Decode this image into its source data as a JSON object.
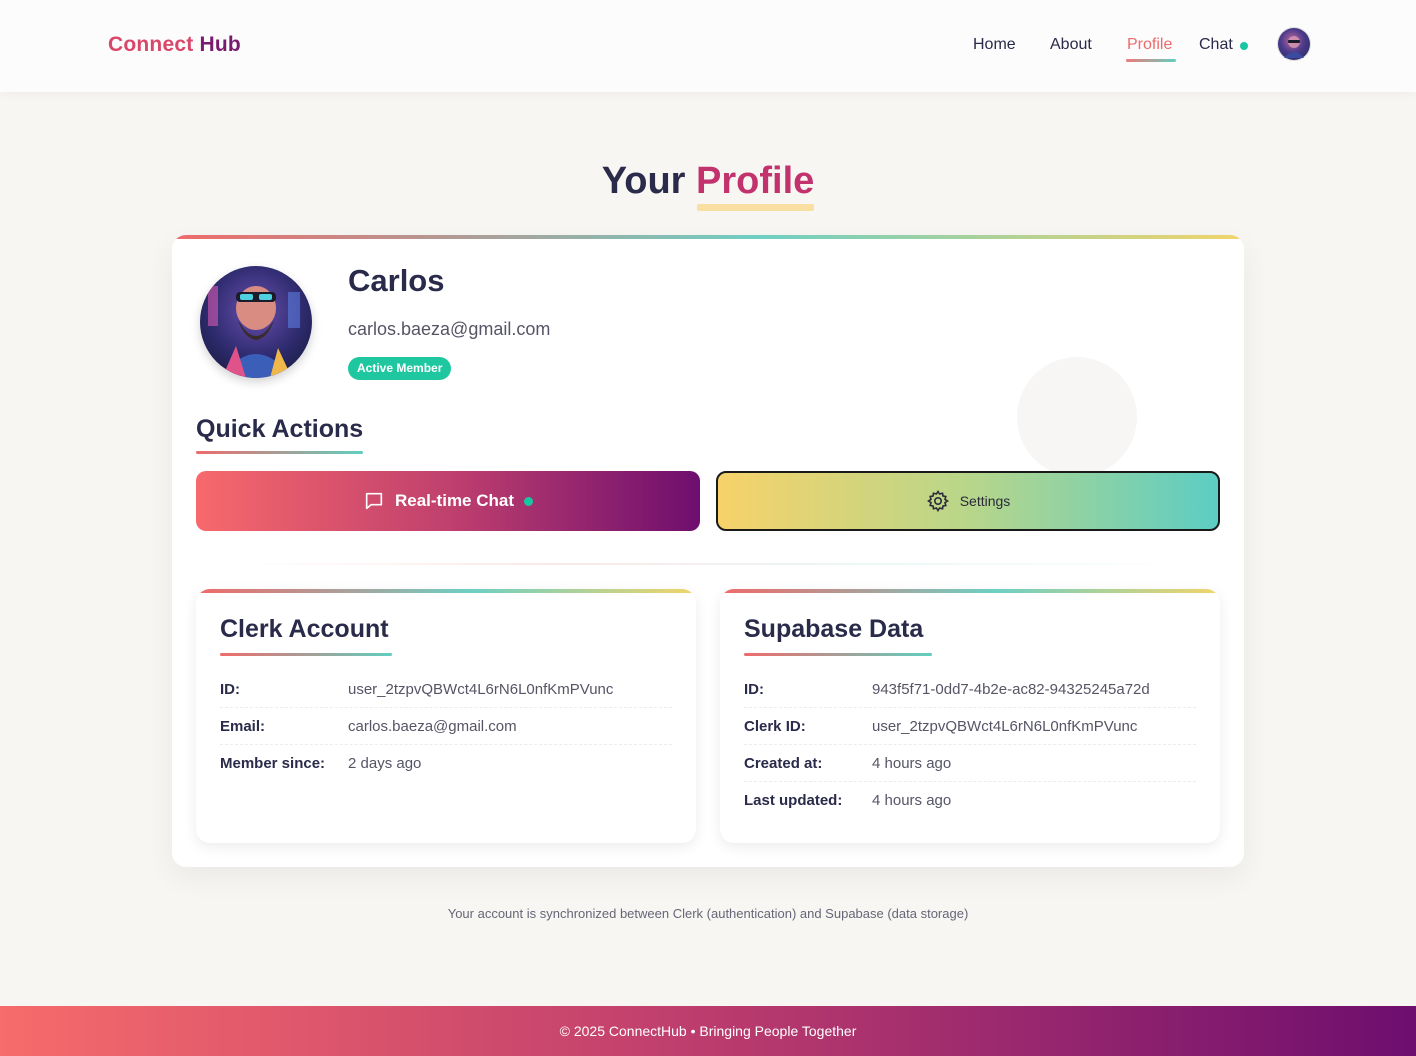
{
  "header": {
    "logo_part1": "Connect",
    "logo_part2": "Hub",
    "nav": [
      {
        "label": "Home"
      },
      {
        "label": "About"
      },
      {
        "label": "Profile"
      },
      {
        "label": "Chat"
      }
    ],
    "active_nav": "Profile"
  },
  "page": {
    "title_part1": "Your",
    "title_part2": "Profile"
  },
  "profile": {
    "name": "Carlos",
    "email": "carlos.baeza@gmail.com",
    "badge": "Active Member"
  },
  "quick_actions": {
    "title": "Quick Actions",
    "chat_label": "Real-time Chat",
    "settings_label": "Settings"
  },
  "clerk": {
    "title": "Clerk Account",
    "rows": [
      {
        "key": "ID:",
        "value": "user_2tzpvQBWct4L6rN6L0nfKmPVunc"
      },
      {
        "key": "Email:",
        "value": "carlos.baeza@gmail.com"
      },
      {
        "key": "Member since:",
        "value": "2 days ago"
      }
    ]
  },
  "supabase": {
    "title": "Supabase Data",
    "rows": [
      {
        "key": "ID:",
        "value": "943f5f71-0dd7-4b2e-ac82-94325245a72d"
      },
      {
        "key": "Clerk ID:",
        "value": "user_2tzpvQBWct4L6rN6L0nfKmPVunc"
      },
      {
        "key": "Created at:",
        "value": "4 hours ago"
      },
      {
        "key": "Last updated:",
        "value": "4 hours ago"
      }
    ]
  },
  "sync_note": "Your account is synchronized between Clerk (authentication) and Supabase (data storage)",
  "footer": "© 2025 ConnectHub • Bringing People Together",
  "colors": {
    "accent_coral": "#ee6b6b",
    "accent_purple": "#6e0e6e",
    "accent_teal": "#5fcfc0",
    "status_green": "#18c7a2"
  }
}
